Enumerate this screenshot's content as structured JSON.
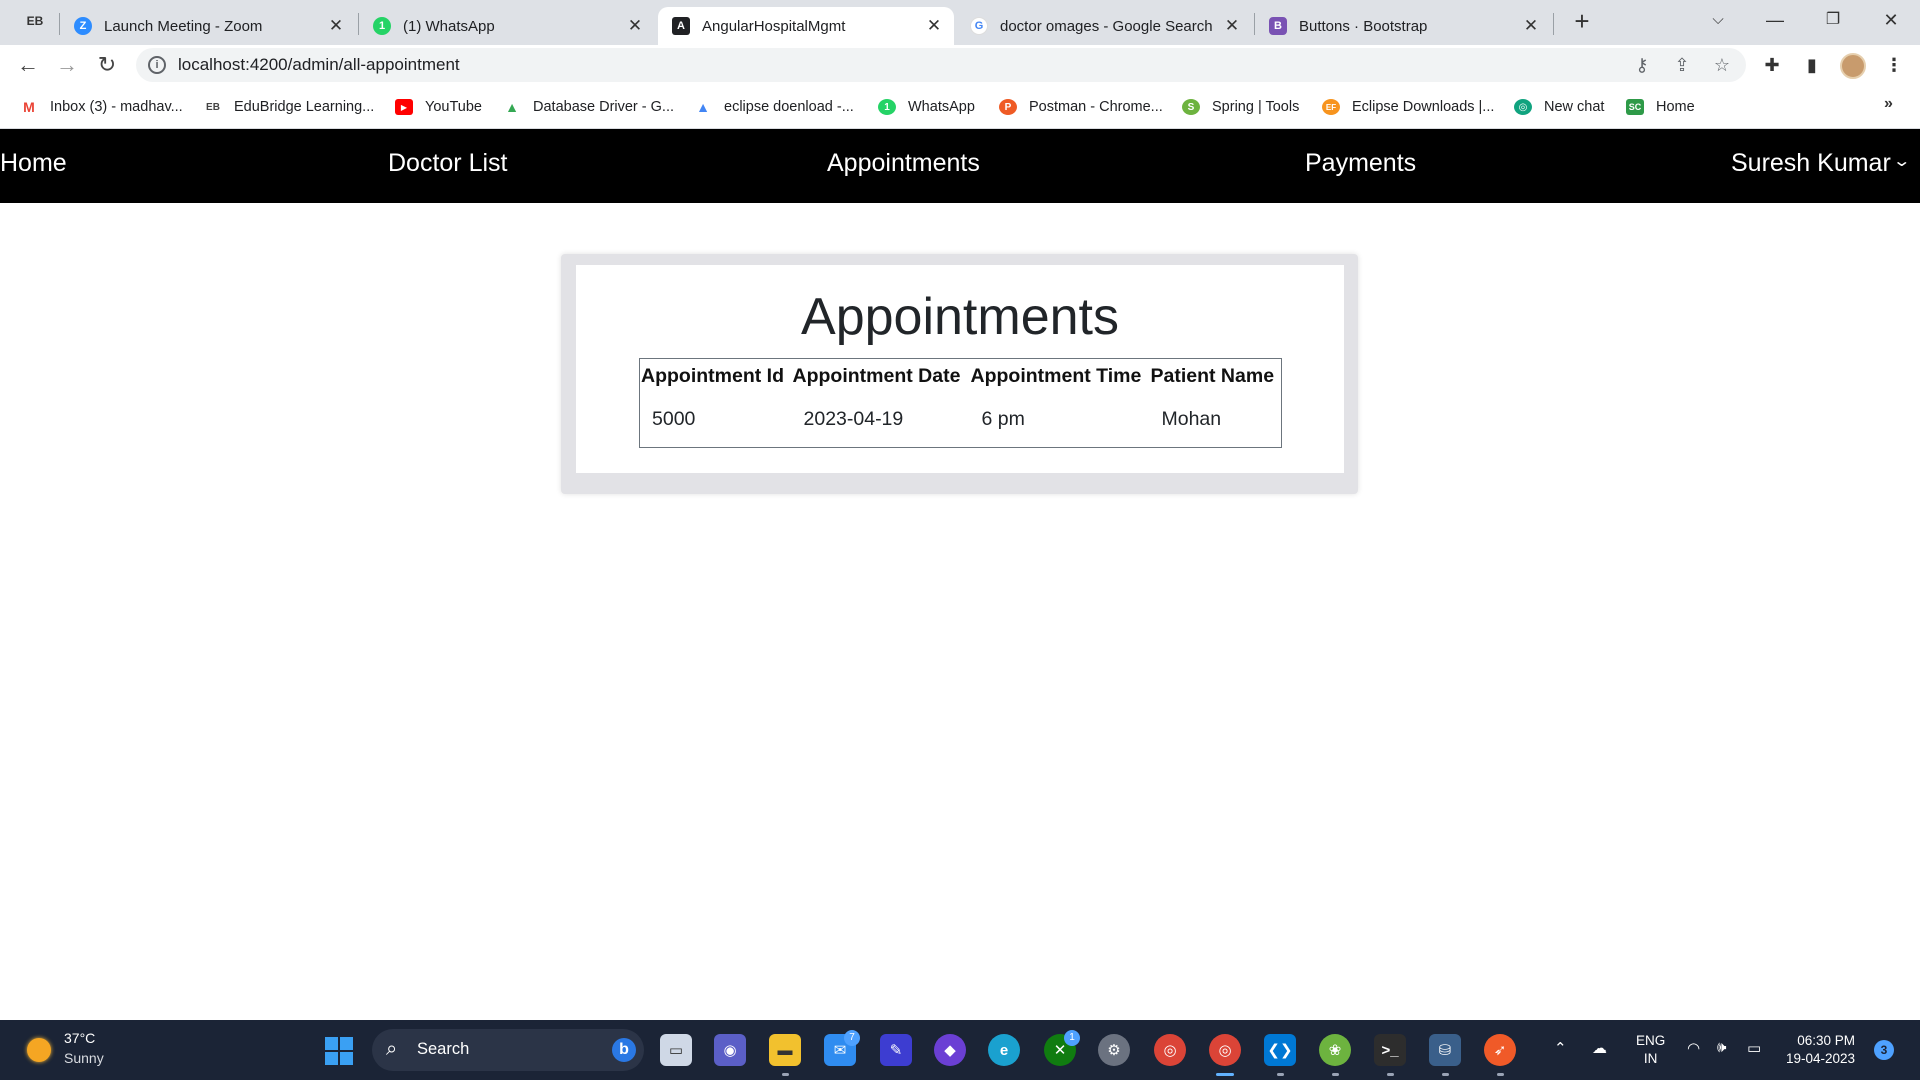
{
  "browser": {
    "profile_badge": "EB",
    "tabs": [
      {
        "label": "Launch Meeting - Zoom",
        "icon": "zoom-icon",
        "color": "#2d8cff",
        "glyph": "Z"
      },
      {
        "label": "(1) WhatsApp",
        "icon": "whatsapp-icon",
        "color": "#25d366",
        "glyph": "1"
      },
      {
        "label": "AngularHospitalMgmt",
        "icon": "angular-icon",
        "color": "#202124",
        "glyph": "A",
        "active": true
      },
      {
        "label": "doctor omages - Google Search",
        "icon": "google-icon",
        "color": "#4285f4",
        "glyph": "G"
      },
      {
        "label": "Buttons · Bootstrap",
        "icon": "bootstrap-icon",
        "color": "#7952b3",
        "glyph": "B"
      }
    ],
    "new_tab": "+",
    "url": "localhost:4200/admin/all-appointment",
    "bookmarks": [
      {
        "label": "Inbox (3) - madhav...",
        "icon": "gmail-icon",
        "color": "#ea4335",
        "glyph": "M"
      },
      {
        "label": "EduBridge Learning...",
        "icon": "edubridge-icon",
        "color": "#555555",
        "glyph": "EB"
      },
      {
        "label": "YouTube",
        "icon": "youtube-icon",
        "color": "#ff0000",
        "glyph": "▶"
      },
      {
        "label": "Database Driver - G...",
        "icon": "google-drive-icon",
        "color": "#34a853",
        "glyph": "▲"
      },
      {
        "label": "eclipse doenload -...",
        "icon": "google-drive-icon",
        "color": "#4285f4",
        "glyph": "▲"
      },
      {
        "label": "WhatsApp",
        "icon": "whatsapp-icon",
        "color": "#25d366",
        "glyph": "1"
      },
      {
        "label": "Postman - Chrome...",
        "icon": "postman-icon",
        "color": "#ef5b25",
        "glyph": "P"
      },
      {
        "label": "Spring | Tools",
        "icon": "spring-icon",
        "color": "#6db33f",
        "glyph": "S"
      },
      {
        "label": "Eclipse Downloads |...",
        "icon": "eclipse-icon",
        "color": "#f7941e",
        "glyph": "EF"
      },
      {
        "label": "New chat",
        "icon": "chatgpt-icon",
        "color": "#10a37f",
        "glyph": "◎"
      },
      {
        "label": "Home",
        "icon": "sc-icon",
        "color": "#2e9a48",
        "glyph": "SC"
      }
    ],
    "bookmarks_more": "»"
  },
  "app": {
    "nav": {
      "home": "Home",
      "doctor_list": "Doctor List",
      "appointments": "Appointments",
      "payments": "Payments",
      "user": "Suresh Kumar"
    },
    "page_title": "Appointments",
    "table": {
      "headers": [
        "Appointment Id",
        "Appointment Date",
        "Appointment Time",
        "Patient Name"
      ],
      "rows": [
        [
          "5000",
          "2023-04-19",
          "6 pm",
          "Mohan"
        ]
      ]
    }
  },
  "taskbar": {
    "weather_temp": "37°C",
    "weather_cond": "Sunny",
    "search_placeholder": "Search",
    "mail_badge": "7",
    "xbox_badge": "1",
    "lang_line1": "ENG",
    "lang_line2": "IN",
    "time": "06:30 PM",
    "date": "19-04-2023",
    "notification_count": "3"
  }
}
